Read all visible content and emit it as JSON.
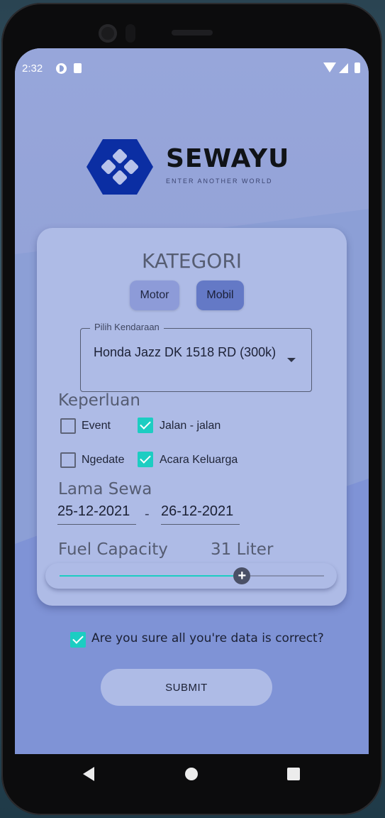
{
  "status_bar": {
    "time": "2:32"
  },
  "logo": {
    "brand": "SEWAYU",
    "tagline": "ENTER ANOTHER WORLD"
  },
  "kategori": {
    "title": "KATEGORI",
    "options": [
      {
        "label": "Motor",
        "selected": false
      },
      {
        "label": "Mobil",
        "selected": true
      }
    ]
  },
  "vehicle_select": {
    "label": "Pilih Kendaraan",
    "value": "Honda Jazz DK 1518 RD (300k)"
  },
  "keperluan": {
    "title": "Keperluan",
    "items": [
      {
        "label": "Event",
        "checked": false
      },
      {
        "label": "Jalan - jalan",
        "checked": true
      },
      {
        "label": "Ngedate",
        "checked": false
      },
      {
        "label": "Acara Keluarga",
        "checked": true
      }
    ]
  },
  "lama_sewa": {
    "title": "Lama Sewa",
    "start_date": "25-12-2021",
    "separator": "-",
    "end_date": "26-12-2021"
  },
  "fuel": {
    "title": "Fuel Capacity",
    "value_label": "31 Liter",
    "level_fraction": 0.69
  },
  "confirm": {
    "label": "Are you sure all you're data is correct?",
    "checked": true
  },
  "submit": {
    "label": "SUBMIT"
  },
  "colors": {
    "accent": "#1ccdc2",
    "card": "#aebbe6",
    "background": "#8c9fd6",
    "selected_button": "#6479c6",
    "logo_blue": "#0b2ea3"
  }
}
